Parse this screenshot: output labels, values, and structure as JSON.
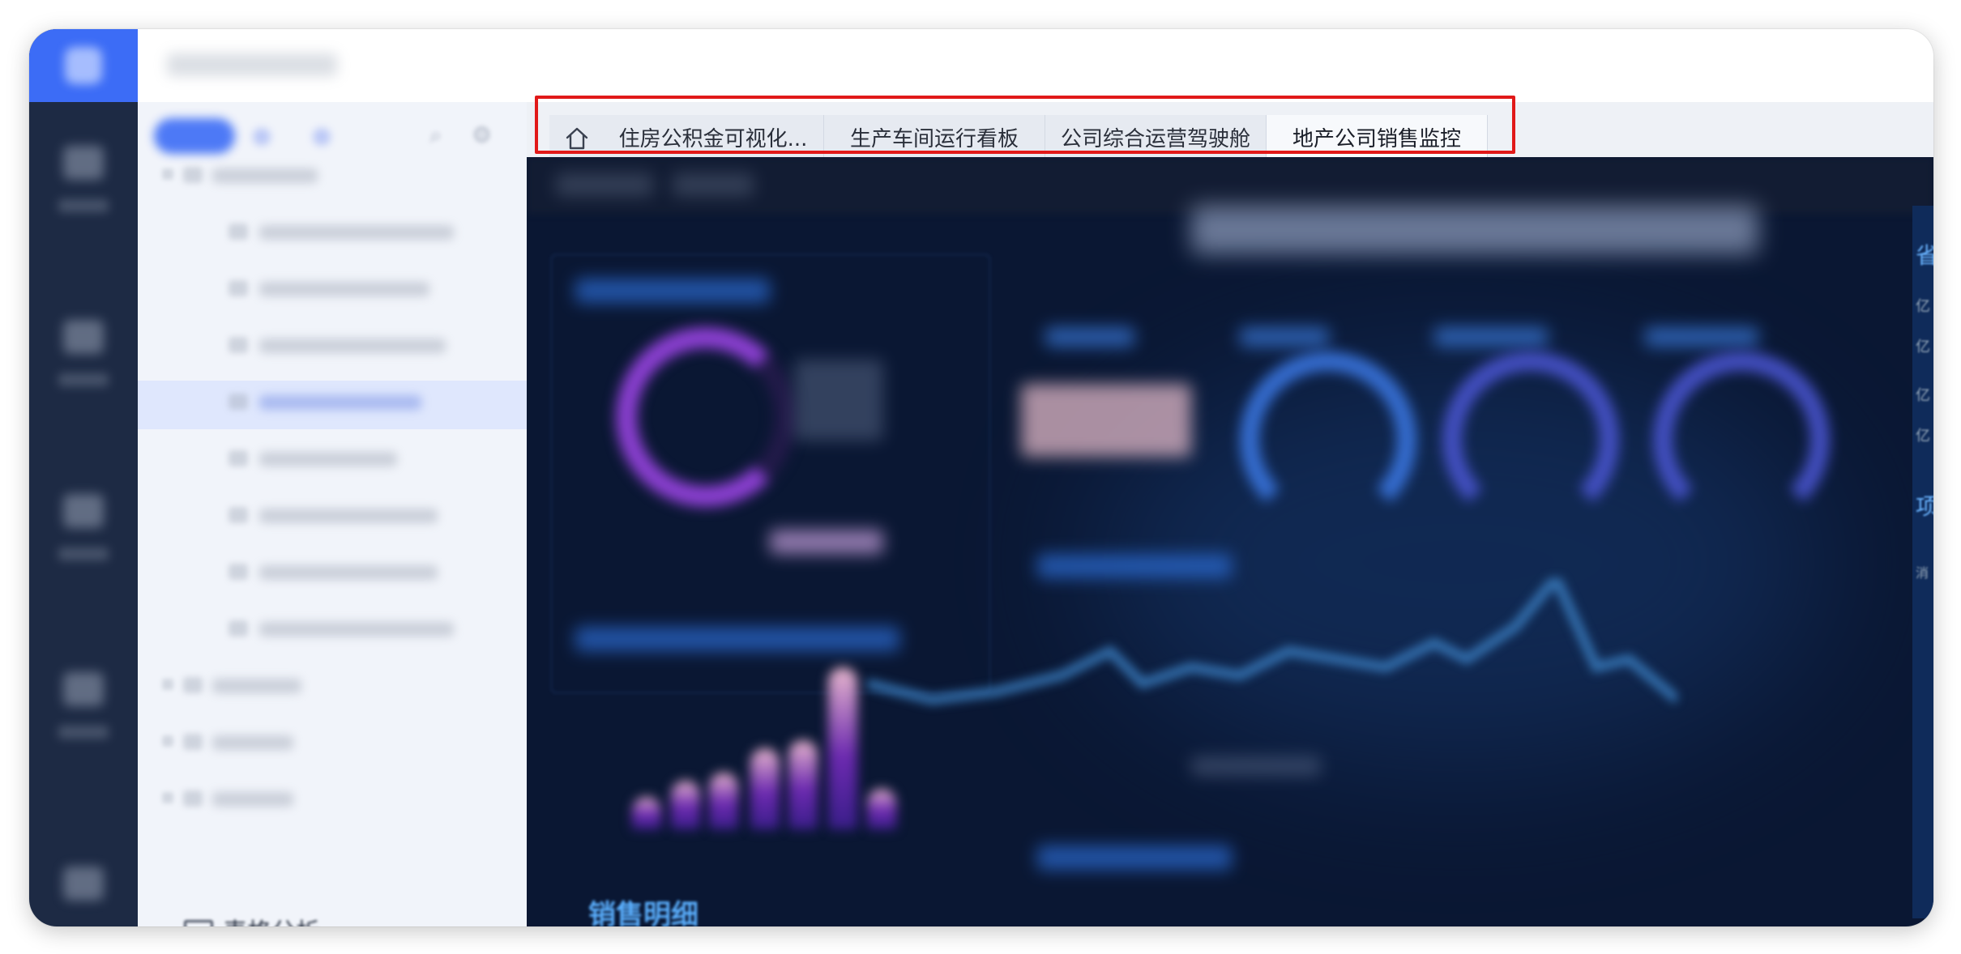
{
  "tabs": [
    {
      "label": "住房公积金可视化...",
      "active": false
    },
    {
      "label": "生产车间运行看板",
      "active": false
    },
    {
      "label": "公司综合运营驾驶舱",
      "active": false
    },
    {
      "label": "地产公司销售监控",
      "active": true
    }
  ],
  "home_tab": {
    "icon": "home-icon"
  },
  "tree": {
    "last_item_label": "表格分析",
    "last_item_icon": "folder-icon"
  },
  "dashboard": {
    "bottom_section_label": "销售明细",
    "right_edge_chars": [
      "省",
      "亿",
      "亿",
      "亿",
      "亿",
      "项",
      "消"
    ]
  },
  "colors": {
    "rail_bg": "#1d2a44",
    "brand_blue": "#3c6cf6",
    "dash_bg": "#0a1733",
    "highlight_frame": "#e11919"
  }
}
